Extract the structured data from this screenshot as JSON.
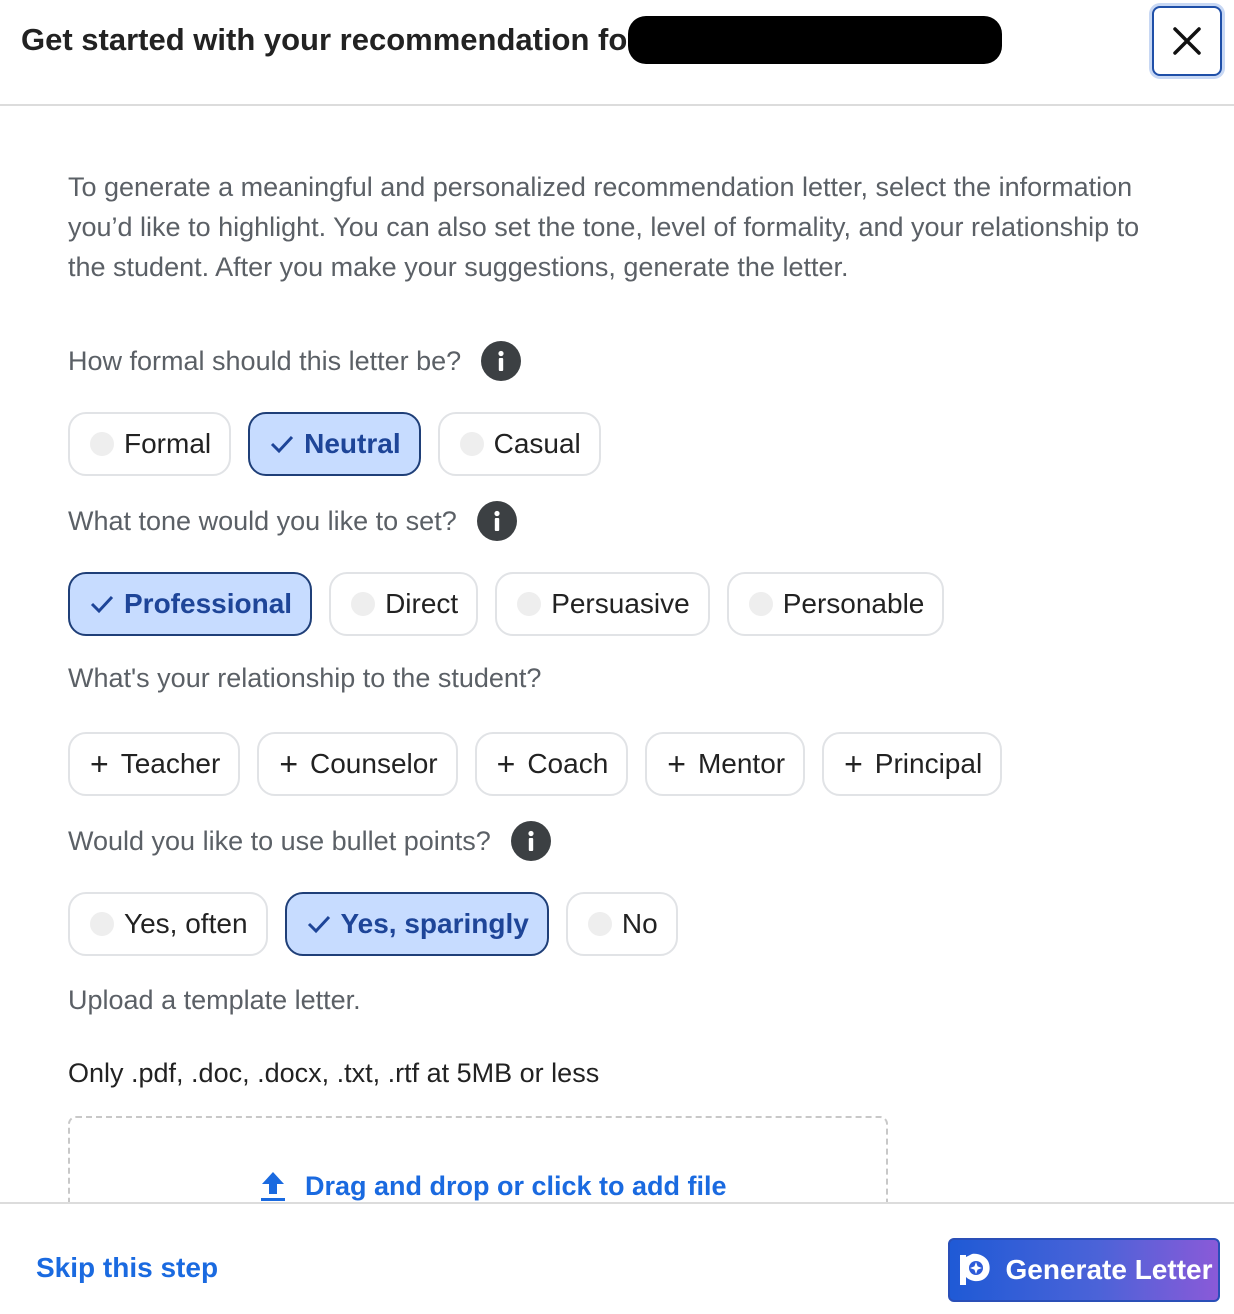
{
  "header": {
    "title": "Get started with your recommendation for",
    "close_icon": "close-icon"
  },
  "intro": "To generate a meaningful and personalized recommendation letter, select the information you’d like to highlight. You can also set the tone, level of formality, and your relationship to the student. After you make your suggestions, generate the letter.",
  "formality": {
    "question": "How formal should this letter be?",
    "options": [
      {
        "label": "Formal",
        "selected": false
      },
      {
        "label": "Neutral",
        "selected": true
      },
      {
        "label": "Casual",
        "selected": false
      }
    ]
  },
  "tone": {
    "question": "What tone would you like to set?",
    "options": [
      {
        "label": "Professional",
        "selected": true
      },
      {
        "label": "Direct",
        "selected": false
      },
      {
        "label": "Persuasive",
        "selected": false
      },
      {
        "label": "Personable",
        "selected": false
      }
    ]
  },
  "relationship": {
    "question": "What's your relationship to the student?",
    "options": [
      "Teacher",
      "Counselor",
      "Coach",
      "Mentor",
      "Principal"
    ]
  },
  "bullets": {
    "question": "Would you like to use bullet points?",
    "options": [
      {
        "label": "Yes, often",
        "selected": false
      },
      {
        "label": "Yes, sparingly",
        "selected": true
      },
      {
        "label": "No",
        "selected": false
      }
    ]
  },
  "upload": {
    "label": "Upload a template letter.",
    "note": "Only .pdf, .doc, .docx, .txt, .rtf at 5MB or less",
    "dropzone_text": "Drag and drop or click to add file"
  },
  "footer": {
    "skip_label": "Skip this step",
    "generate_label": "Generate Letter"
  },
  "colors": {
    "selected_bg": "#c7dcff",
    "selected_text": "#1e4598",
    "link": "#1a6ae0"
  }
}
